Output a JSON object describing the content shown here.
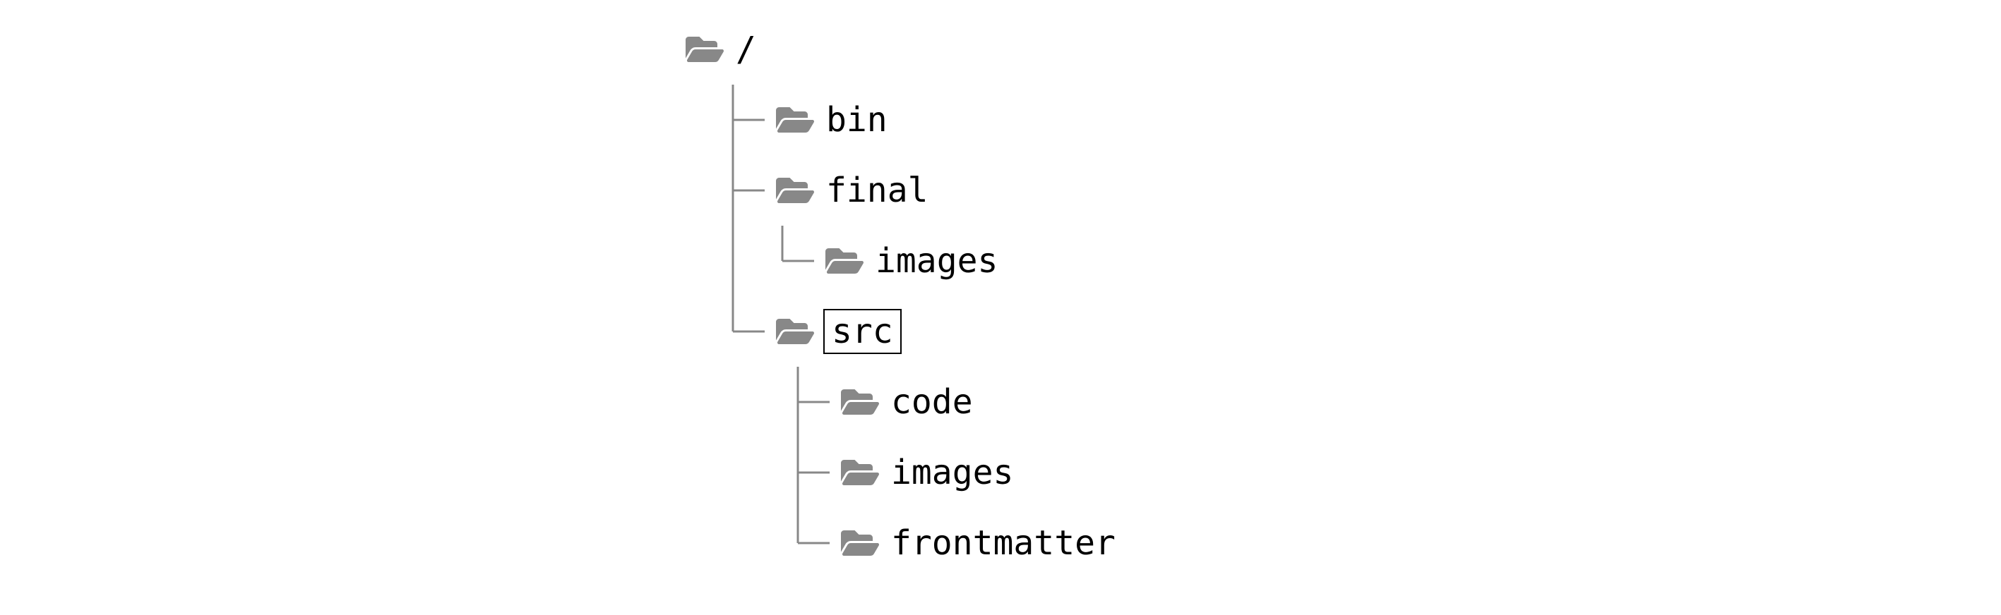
{
  "tree": {
    "root": {
      "label": "/",
      "boxed": false
    },
    "items": [
      {
        "label": "bin",
        "depth": 1,
        "connector": "tee",
        "boxed": false
      },
      {
        "label": "final",
        "depth": 1,
        "connector": "tee",
        "boxed": false
      },
      {
        "label": "images",
        "depth": 2,
        "connector": "elbow",
        "parent_continues": true,
        "boxed": false
      },
      {
        "label": "src",
        "depth": 1,
        "connector": "elbow",
        "boxed": true
      },
      {
        "label": "code",
        "depth": 2,
        "connector": "tee",
        "parent_continues": false,
        "boxed": false
      },
      {
        "label": "images",
        "depth": 2,
        "connector": "tee",
        "parent_continues": false,
        "boxed": false
      },
      {
        "label": "frontmatter",
        "depth": 2,
        "connector": "elbow",
        "parent_continues": false,
        "boxed": false
      }
    ]
  }
}
